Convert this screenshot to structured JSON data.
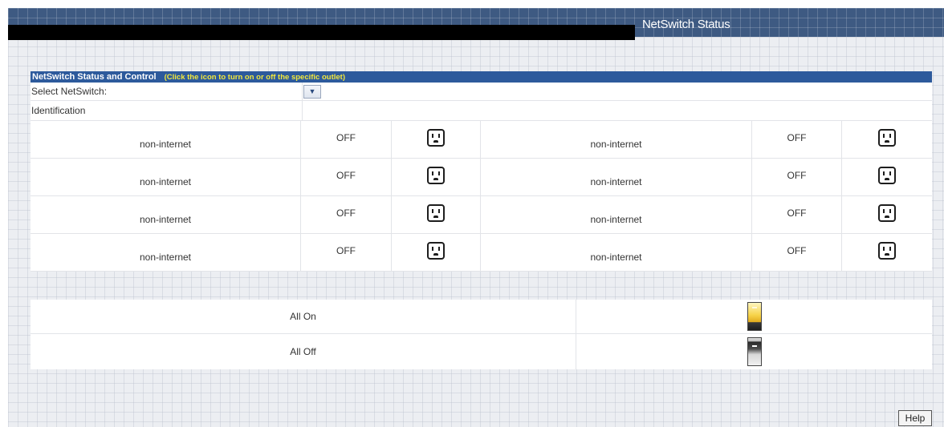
{
  "header": {
    "title": "NetSwitch Status"
  },
  "panel": {
    "title": "NetSwitch Status and Control",
    "hint": "(Click the icon to turn on or off the specific outlet)",
    "select_label": "Select NetSwitch:",
    "select_value": "",
    "identification_label": "Identification",
    "identification_value": ""
  },
  "outlets": [
    [
      {
        "name": "non-internet",
        "state": "OFF",
        "icon": "power-outlet-icon"
      },
      {
        "name": "non-internet",
        "state": "OFF",
        "icon": "power-outlet-icon"
      }
    ],
    [
      {
        "name": "non-internet",
        "state": "OFF",
        "icon": "power-outlet-icon"
      },
      {
        "name": "non-internet",
        "state": "OFF",
        "icon": "power-outlet-icon"
      }
    ],
    [
      {
        "name": "non-internet",
        "state": "OFF",
        "icon": "power-outlet-icon"
      },
      {
        "name": "non-internet",
        "state": "OFF",
        "icon": "power-outlet-icon"
      }
    ],
    [
      {
        "name": "non-internet",
        "state": "OFF",
        "icon": "power-outlet-icon"
      },
      {
        "name": "non-internet",
        "state": "OFF",
        "icon": "power-outlet-icon"
      }
    ]
  ],
  "bulk": {
    "all_on_label": "All On",
    "all_off_label": "All Off",
    "all_on_icon": "switch-on-icon",
    "all_off_icon": "switch-off-icon"
  },
  "footer": {
    "help_label": "Help"
  },
  "colors": {
    "header_band": "#3e5a82",
    "panel_header": "#2d5a9c",
    "hint_text": "#f2e83c",
    "background": "#eceef2"
  }
}
